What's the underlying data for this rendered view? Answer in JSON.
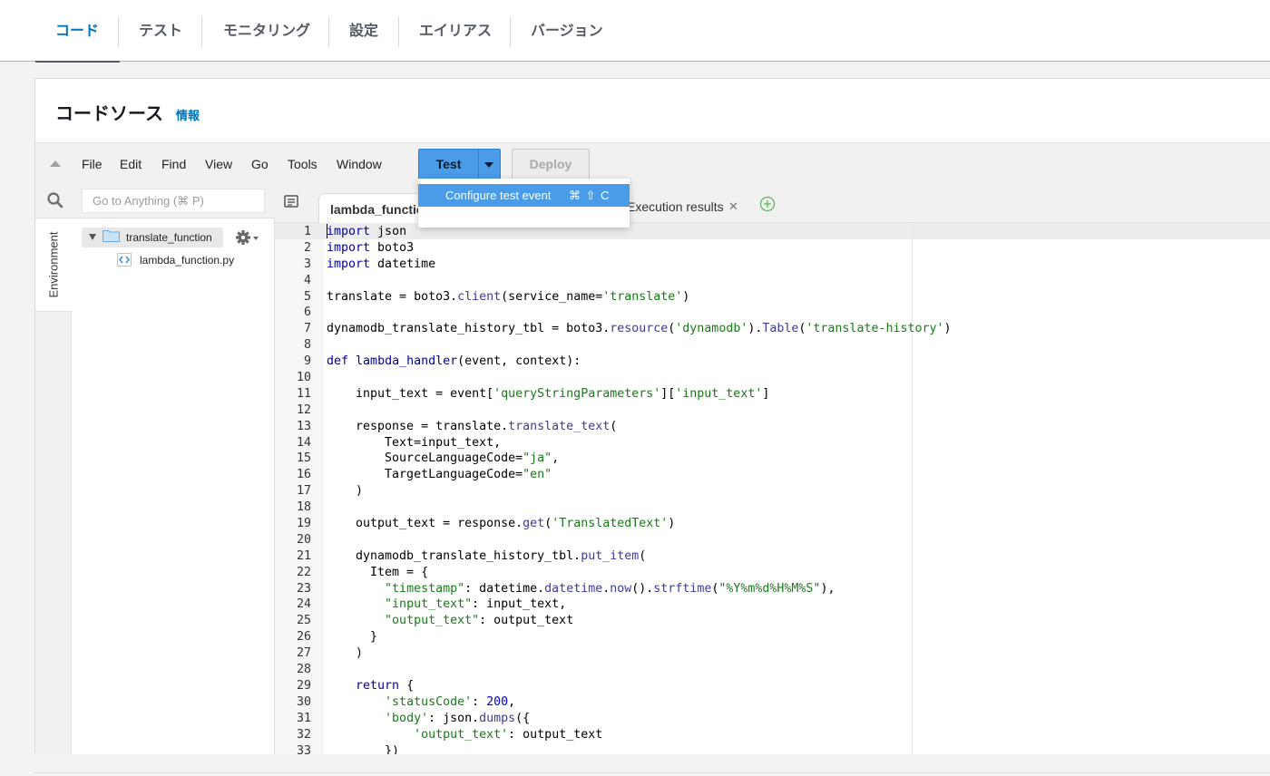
{
  "tabs": [
    {
      "label": "コード",
      "active": true
    },
    {
      "label": "テスト"
    },
    {
      "label": "モニタリング"
    },
    {
      "label": "設定"
    },
    {
      "label": "エイリアス"
    },
    {
      "label": "バージョン"
    }
  ],
  "panel": {
    "title": "コードソース",
    "info": "情報"
  },
  "menubar": {
    "items": [
      "File",
      "Edit",
      "Find",
      "View",
      "Go",
      "Tools",
      "Window"
    ],
    "test_label": "Test",
    "deploy_label": "Deploy"
  },
  "dropdown": {
    "item_label": "Configure test event",
    "shortcut": "⌘ ⇧ C"
  },
  "search": {
    "placeholder": "Go to Anything (⌘ P)"
  },
  "sidebar": {
    "env_tab": "Environment",
    "root": "translate_function",
    "file": "lambda_function.py"
  },
  "editor_tabs": {
    "active": "lambda_function.py",
    "exec": "Execution results"
  },
  "code": {
    "lines": [
      [
        [
          "kw",
          "import"
        ],
        [
          "t",
          " json"
        ]
      ],
      [
        [
          "kw",
          "import"
        ],
        [
          "t",
          " boto3"
        ]
      ],
      [
        [
          "kw",
          "import"
        ],
        [
          "t",
          " datetime"
        ]
      ],
      [],
      [
        [
          "t",
          "translate = boto3."
        ],
        [
          "mth",
          "client"
        ],
        [
          "t",
          "(service_name="
        ],
        [
          "str",
          "'translate'"
        ],
        [
          "t",
          ")"
        ]
      ],
      [],
      [
        [
          "t",
          "dynamodb_translate_history_tbl = boto3."
        ],
        [
          "mth",
          "resource"
        ],
        [
          "t",
          "("
        ],
        [
          "str",
          "'dynamodb'"
        ],
        [
          "t",
          ")."
        ],
        [
          "mth",
          "Table"
        ],
        [
          "t",
          "("
        ],
        [
          "str",
          "'translate-history'"
        ],
        [
          "t",
          ")"
        ]
      ],
      [],
      [
        [
          "kw",
          "def"
        ],
        [
          "t",
          " "
        ],
        [
          "fn",
          "lambda_handler"
        ],
        [
          "t",
          "(event, context):"
        ]
      ],
      [],
      [
        [
          "t",
          "    input_text = event["
        ],
        [
          "str",
          "'queryStringParameters'"
        ],
        [
          "t",
          "]["
        ],
        [
          "str",
          "'input_text'"
        ],
        [
          "t",
          "]"
        ]
      ],
      [],
      [
        [
          "t",
          "    response = translate."
        ],
        [
          "mth",
          "translate_text"
        ],
        [
          "t",
          "("
        ]
      ],
      [
        [
          "t",
          "        Text=input_text,"
        ]
      ],
      [
        [
          "t",
          "        SourceLanguageCode="
        ],
        [
          "str",
          "\"ja\""
        ],
        [
          "t",
          ","
        ]
      ],
      [
        [
          "t",
          "        TargetLanguageCode="
        ],
        [
          "str",
          "\"en\""
        ]
      ],
      [
        [
          "t",
          "    )"
        ]
      ],
      [],
      [
        [
          "t",
          "    output_text = response."
        ],
        [
          "mth",
          "get"
        ],
        [
          "t",
          "("
        ],
        [
          "str",
          "'TranslatedText'"
        ],
        [
          "t",
          ")"
        ]
      ],
      [],
      [
        [
          "t",
          "    dynamodb_translate_history_tbl."
        ],
        [
          "mth",
          "put_item"
        ],
        [
          "t",
          "("
        ]
      ],
      [
        [
          "t",
          "      Item = {"
        ]
      ],
      [
        [
          "t",
          "        "
        ],
        [
          "str",
          "\"timestamp\""
        ],
        [
          "t",
          ": datetime."
        ],
        [
          "mth",
          "datetime"
        ],
        [
          "t",
          "."
        ],
        [
          "mth",
          "now"
        ],
        [
          "t",
          "()."
        ],
        [
          "mth",
          "strftime"
        ],
        [
          "t",
          "("
        ],
        [
          "str",
          "\"%Y%m%d%H%M%S\""
        ],
        [
          "t",
          "),"
        ]
      ],
      [
        [
          "t",
          "        "
        ],
        [
          "str",
          "\"input_text\""
        ],
        [
          "t",
          ": input_text,"
        ]
      ],
      [
        [
          "t",
          "        "
        ],
        [
          "str",
          "\"output_text\""
        ],
        [
          "t",
          ": output_text"
        ]
      ],
      [
        [
          "t",
          "      }"
        ]
      ],
      [
        [
          "t",
          "    )"
        ]
      ],
      [],
      [
        [
          "t",
          "    "
        ],
        [
          "kw",
          "return"
        ],
        [
          "t",
          " {"
        ]
      ],
      [
        [
          "t",
          "        "
        ],
        [
          "str",
          "'statusCode'"
        ],
        [
          "t",
          ": "
        ],
        [
          "num",
          "200"
        ],
        [
          "t",
          ","
        ]
      ],
      [
        [
          "t",
          "        "
        ],
        [
          "str",
          "'body'"
        ],
        [
          "t",
          ": json."
        ],
        [
          "mth",
          "dumps"
        ],
        [
          "t",
          "({"
        ]
      ],
      [
        [
          "t",
          "            "
        ],
        [
          "str",
          "'output_text'"
        ],
        [
          "t",
          ": output_text"
        ]
      ],
      [
        [
          "t",
          "        })"
        ]
      ]
    ]
  }
}
